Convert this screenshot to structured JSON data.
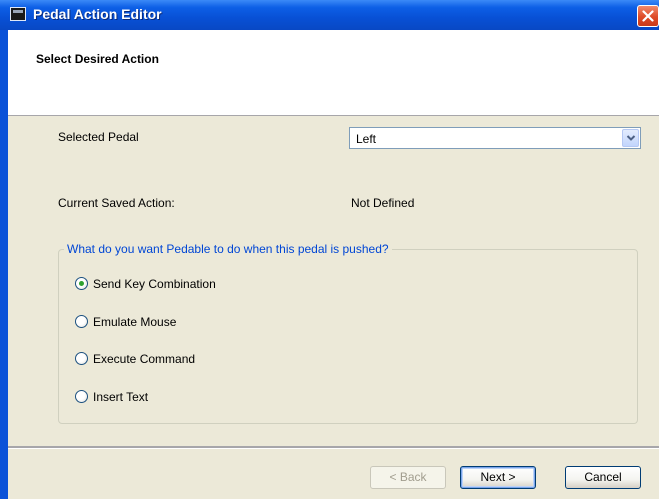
{
  "window": {
    "title": "Pedal Action Editor"
  },
  "header": {
    "title": "Select Desired Action"
  },
  "pedal": {
    "label": "Selected Pedal",
    "value": "Left"
  },
  "saved_action": {
    "label": "Current Saved Action:",
    "value": "Not Defined"
  },
  "group": {
    "legend": "What do you want Pedable to do when this pedal is pushed?",
    "options": [
      {
        "label": "Send Key Combination",
        "checked": true
      },
      {
        "label": "Emulate Mouse",
        "checked": false
      },
      {
        "label": "Execute Command",
        "checked": false
      },
      {
        "label": "Insert Text",
        "checked": false
      }
    ]
  },
  "buttons": {
    "back": "< Back",
    "next": "Next >",
    "cancel": "Cancel"
  },
  "colors": {
    "titlebar": "#0850d5",
    "group_legend": "#0046d5",
    "dialog_bg": "#ece9d8",
    "radio_dot": "#2ea12e"
  },
  "icons": {
    "app": "app-window-icon",
    "close": "close-icon",
    "dropdown": "chevron-down-icon"
  }
}
